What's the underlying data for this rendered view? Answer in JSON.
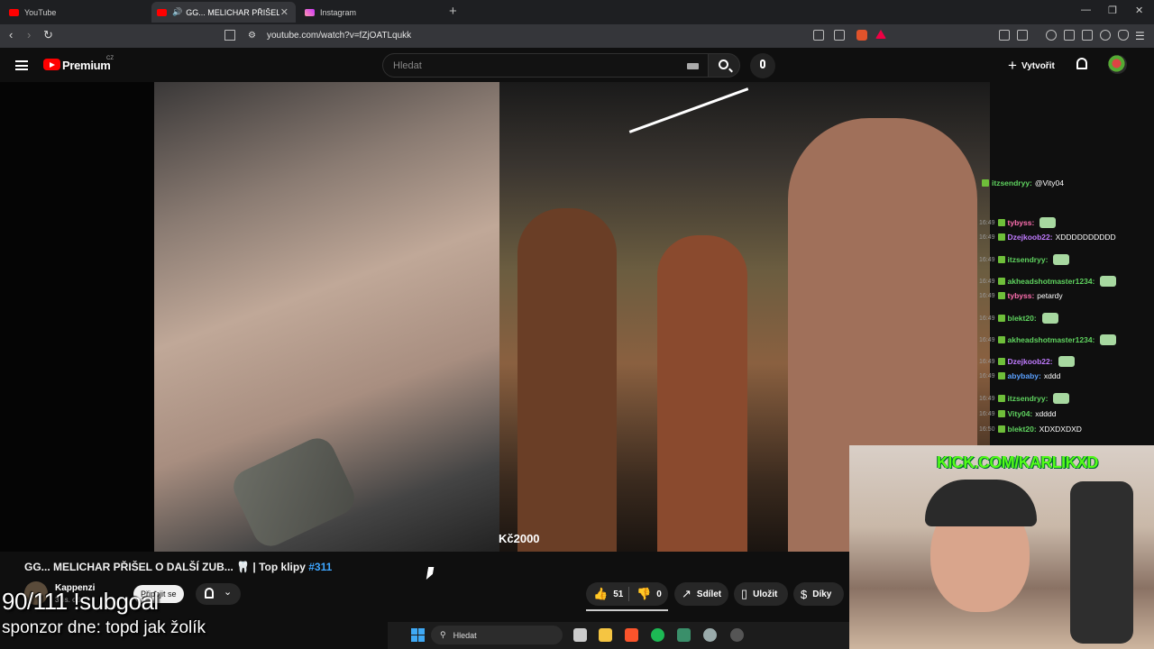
{
  "browser": {
    "tabs": [
      {
        "label": "YouTube"
      },
      {
        "label": "GG... MELICHAR PŘIŠEL O DA"
      },
      {
        "label": "Instagram"
      }
    ],
    "url": "youtube.com/watch?v=fZjOATLqukk"
  },
  "youtube": {
    "brand": "Premium",
    "region": "CZ",
    "search_placeholder": "Hledat",
    "create_label": "Vytvořit"
  },
  "video": {
    "donation_text": "Kč2000",
    "title": "GG... MELICHAR PŘIŠEL O DALŠÍ ZUB... 🦷 | Top klipy ",
    "title_tag": "#311",
    "channel_name": "Kappenzi",
    "channel_subs": "3 tis. od...",
    "join_label": "Připojit se",
    "likes": "51",
    "dislikes": "0",
    "share_label": "Sdílet",
    "save_label": "Uložit",
    "thanks_label": "Díky"
  },
  "chat": [
    {
      "time": "",
      "user": "itzsendryy:",
      "user_color": "#5fd35f",
      "message": "@Vity04"
    },
    {
      "time": "16:49",
      "user": "tybyss:",
      "user_color": "#ff6fb0",
      "message": ""
    },
    {
      "time": "16:49",
      "user": "Dzejkoob22:",
      "user_color": "#c07bff",
      "message": "XDDDDDDDDDD"
    },
    {
      "time": "16:49",
      "user": "itzsendryy:",
      "user_color": "#5fd35f",
      "message": ""
    },
    {
      "time": "16:49",
      "user": "akheadshotmaster1234:",
      "user_color": "#5fd35f",
      "message": ""
    },
    {
      "time": "16:49",
      "user": "tybyss:",
      "user_color": "#ff6fb0",
      "message": "petardy"
    },
    {
      "time": "16:49",
      "user": "blekt20:",
      "user_color": "#5fd35f",
      "message": ""
    },
    {
      "time": "16:49",
      "user": "akheadshotmaster1234:",
      "user_color": "#5fd35f",
      "message": ""
    },
    {
      "time": "16:49",
      "user": "Dzejkoob22:",
      "user_color": "#c07bff",
      "message": ""
    },
    {
      "time": "16:49",
      "user": "abybaby:",
      "user_color": "#5aa0ff",
      "message": "xddd"
    },
    {
      "time": "16:49",
      "user": "itzsendryy:",
      "user_color": "#5fd35f",
      "message": ""
    },
    {
      "time": "16:49",
      "user": "Vity04:",
      "user_color": "#5fd35f",
      "message": "xdddd"
    },
    {
      "time": "16:50",
      "user": "blekt20:",
      "user_color": "#5fd35f",
      "message": "XDXDXDXD"
    }
  ],
  "overlay": {
    "kick_url": "KICK.COM/KARLIKXD",
    "subgoal": "90/111 !subgoal",
    "sponsor": "sponzor dne: topd jak žolík"
  },
  "taskbar": {
    "search_label": "Hledat"
  },
  "colors": {
    "accent_red": "#ff0000",
    "link_blue": "#3ea6ff",
    "kick_green": "#53fc18"
  }
}
